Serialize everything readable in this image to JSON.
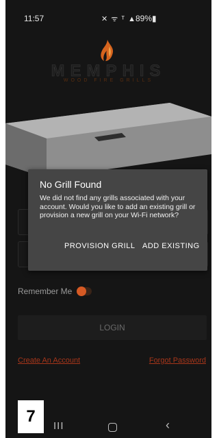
{
  "status_bar": {
    "time": "11:57",
    "signal_icons": "✕ ᯤ ᵀ ▲",
    "battery": "89%▮"
  },
  "brand": {
    "name": "MEMPHIS",
    "tagline": "WOOD FIRE GRILLS",
    "flame_color": "#d6641e"
  },
  "login": {
    "remember_label": "Remember Me",
    "login_label": "LOGIN",
    "create_account_label": "Create An Account",
    "forgot_password_label": "Forgot Password",
    "accent_color": "#d65a24"
  },
  "dialog": {
    "title": "No Grill Found",
    "message": "We did not find any grills associated with your account. Would you like to add an existing grill or provision a new grill on your Wi-Fi network?",
    "provision_label": "PROVISION GRILL",
    "add_existing_label": "ADD EXISTING"
  },
  "nav_bar": {
    "recents": "III",
    "back": "‹"
  },
  "step_badge": "7"
}
